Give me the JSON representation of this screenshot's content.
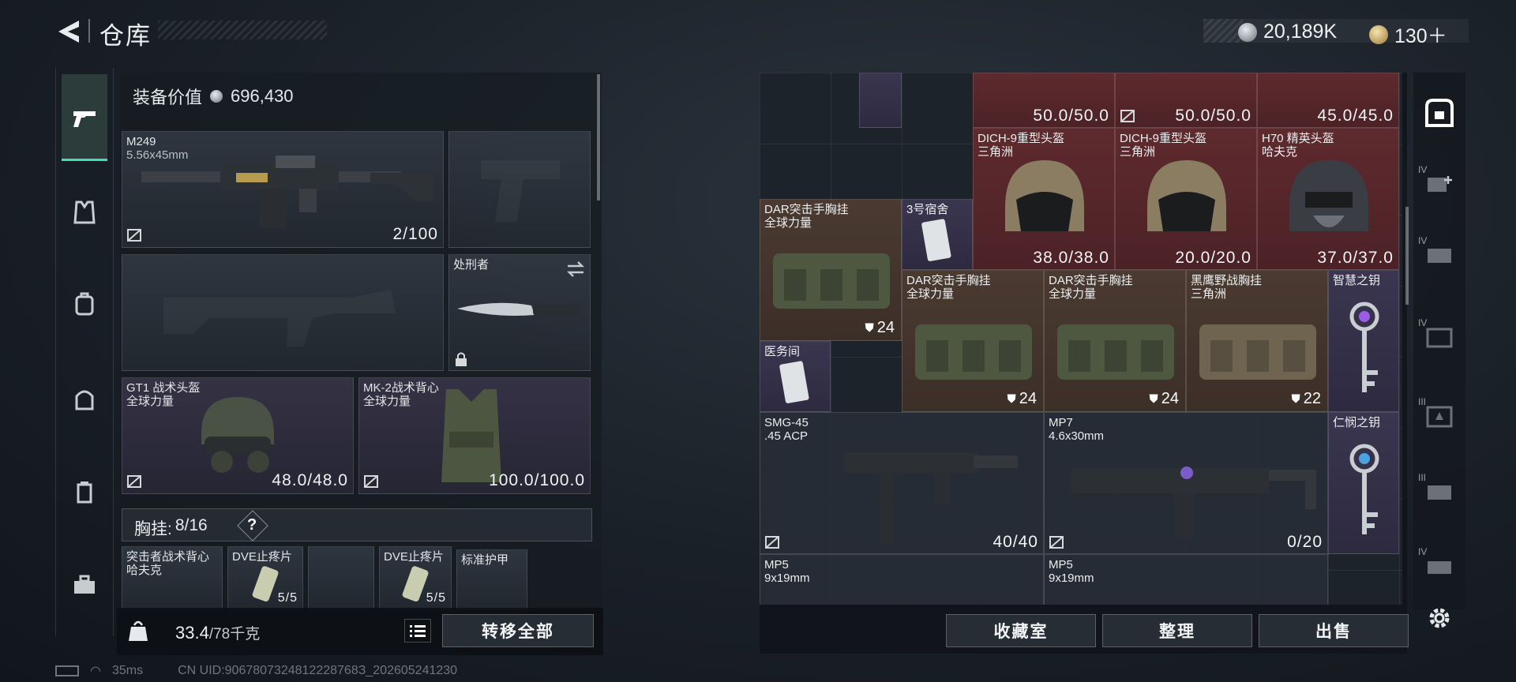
{
  "header": {
    "title": "仓库",
    "currency_silver": "20,189K",
    "currency_gold": "130＋"
  },
  "equipment": {
    "value_label": "装备价值",
    "value": "696,430",
    "primary": {
      "name": "M249",
      "caliber": "5.56x45mm",
      "ammo": "2/100"
    },
    "melee": {
      "name": "处刑者"
    },
    "helmet": {
      "name": "GT1 战术头盔",
      "faction": "全球力量",
      "durability": "48.0/48.0"
    },
    "armor": {
      "name": "MK-2战术背心",
      "faction": "全球力量",
      "durability": "100.0/100.0"
    },
    "chest_rig_label": "胸挂:",
    "chest_rig_capacity": "8/16",
    "help": "?",
    "rig_items": [
      {
        "name": "突击者战术背心",
        "faction": "哈夫克"
      },
      {
        "name": "DVE止疼片",
        "count": "5/5"
      },
      {
        "name": "DVE止疼片",
        "count": "5/5"
      },
      {
        "name": "标准护甲"
      }
    ]
  },
  "footer_left": {
    "weight_current": "33.4",
    "weight_max": "/78千克",
    "transfer_all": "转移全部"
  },
  "storage": {
    "items": {
      "r0a": "50.0/50.0",
      "r0b": "50.0/50.0",
      "r0c": "45.0/45.0",
      "h1": {
        "name": "DICH-9重型头盔",
        "faction": "三角洲",
        "dur": "38.0/38.0"
      },
      "h2": {
        "name": "DICH-9重型头盔",
        "faction": "三角洲",
        "dur": "20.0/20.0"
      },
      "h3": {
        "name": "H70 精英头盔",
        "faction": "哈夫克",
        "dur": "37.0/37.0"
      },
      "rig1": {
        "name": "DAR突击手胸挂",
        "faction": "全球力量",
        "tier": "24"
      },
      "card1": {
        "name": "3号宿舍"
      },
      "rig2": {
        "name": "DAR突击手胸挂",
        "faction": "全球力量",
        "tier": "24"
      },
      "rig3": {
        "name": "DAR突击手胸挂",
        "faction": "全球力量",
        "tier": "24"
      },
      "rig4": {
        "name": "黑鹰野战胸挂",
        "faction": "三角洲",
        "tier": "22"
      },
      "key1": {
        "name": "智慧之钥"
      },
      "card2": {
        "name": "医务间"
      },
      "smg1": {
        "name": "SMG-45",
        "caliber": ".45 ACP",
        "ammo": "40/40"
      },
      "smg2": {
        "name": "MP7",
        "caliber": "4.6x30mm",
        "ammo": "0/20"
      },
      "key2": {
        "name": "仁悯之钥"
      },
      "mp5a": {
        "name": "MP5",
        "caliber": "9x19mm"
      },
      "mp5b": {
        "name": "MP5",
        "caliber": "9x19mm"
      }
    },
    "buttons": {
      "collection": "收藏室",
      "sort": "整理",
      "sell": "出售"
    }
  },
  "side_tabs": [
    "IV",
    "IV",
    "IV",
    "III",
    "III",
    "IV"
  ],
  "status": {
    "ping": "35ms",
    "uid": "CN UID:9067807324812228768З_202605241230"
  },
  "colors": {
    "accent": "#3fe0b4",
    "red_item": "#5e2a2e",
    "brown_item": "#4a3a31",
    "purple_item": "#3a3650"
  }
}
